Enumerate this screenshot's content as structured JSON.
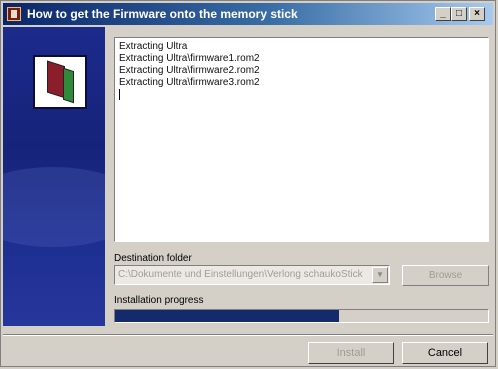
{
  "window": {
    "title": "How to get the Firmware onto the memory stick",
    "min_glyph": "_",
    "max_glyph": "□",
    "close_glyph": "×"
  },
  "log": {
    "lines": [
      "Extracting Ultra",
      "Extracting Ultra\\firmware1.rom2",
      "Extracting Ultra\\firmware2.rom2",
      "Extracting Ultra\\firmware3.rom2"
    ]
  },
  "destination": {
    "label": "Destination folder",
    "value": "C:\\Dokumente und Einstellungen\\Verlong schaukoStick",
    "browse_label": "Browse"
  },
  "progress": {
    "label": "Installation progress",
    "fraction": 0.6
  },
  "buttons": {
    "install": "Install",
    "cancel": "Cancel"
  },
  "colors": {
    "titlebar_start": "#0a246a",
    "sidebar": "#1c2a8c",
    "progress_fill": "#152a6a"
  },
  "icons": {
    "app": "app-icon",
    "logo": "book-logo-icon",
    "combo": "chevron-down-icon"
  }
}
